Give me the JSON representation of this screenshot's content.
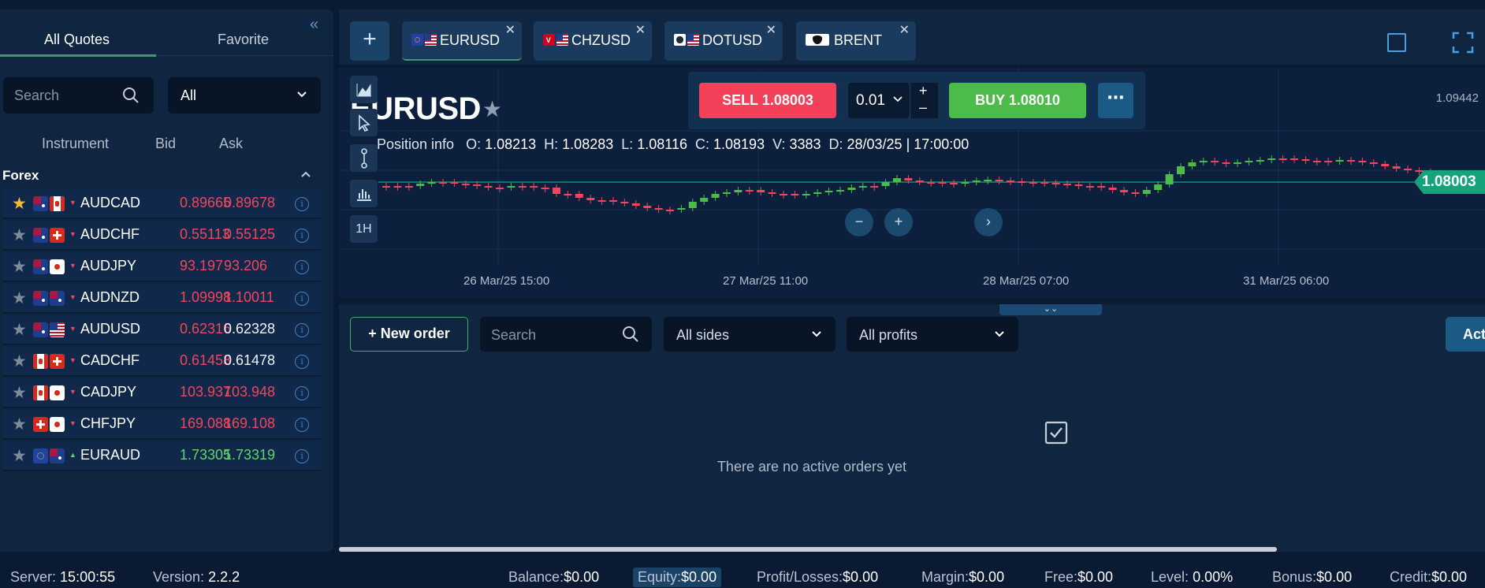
{
  "sidebar": {
    "tabs": [
      "All Quotes",
      "Favorite"
    ],
    "search_placeholder": "Search",
    "filter_value": "All",
    "columns": [
      "Instrument",
      "Bid",
      "Ask"
    ],
    "group": "Forex",
    "quotes": [
      {
        "symbol": "AUDCAD",
        "bid": "0.89665",
        "ask": "0.89678",
        "bid_color": "red",
        "ask_color": "red",
        "dir": "down",
        "fav": true,
        "flags": [
          "au",
          "ca"
        ]
      },
      {
        "symbol": "AUDCHF",
        "bid": "0.55113",
        "ask": "0.55125",
        "bid_color": "red",
        "ask_color": "red",
        "dir": "down",
        "fav": false,
        "flags": [
          "au",
          "ch"
        ]
      },
      {
        "symbol": "AUDJPY",
        "bid": "93.197",
        "ask": "93.206",
        "bid_color": "red",
        "ask_color": "red",
        "dir": "down",
        "fav": false,
        "flags": [
          "au",
          "jp"
        ]
      },
      {
        "symbol": "AUDNZD",
        "bid": "1.09998",
        "ask": "1.10011",
        "bid_color": "red",
        "ask_color": "red",
        "dir": "down",
        "fav": false,
        "flags": [
          "au",
          "nz"
        ]
      },
      {
        "symbol": "AUDUSD",
        "bid": "0.62316",
        "ask": "0.62328",
        "bid_color": "red",
        "ask_color": "white",
        "dir": "down",
        "fav": false,
        "flags": [
          "au",
          "us"
        ]
      },
      {
        "symbol": "CADCHF",
        "bid": "0.61458",
        "ask": "0.61478",
        "bid_color": "red",
        "ask_color": "white",
        "dir": "down",
        "fav": false,
        "flags": [
          "ca",
          "ch"
        ]
      },
      {
        "symbol": "CADJPY",
        "bid": "103.937",
        "ask": "103.948",
        "bid_color": "red",
        "ask_color": "red",
        "dir": "down",
        "fav": false,
        "flags": [
          "ca",
          "jp"
        ]
      },
      {
        "symbol": "CHFJPY",
        "bid": "169.088",
        "ask": "169.108",
        "bid_color": "red",
        "ask_color": "red",
        "dir": "down",
        "fav": false,
        "flags": [
          "ch",
          "jp"
        ]
      },
      {
        "symbol": "EURAUD",
        "bid": "1.73305",
        "ask": "1.73319",
        "bid_color": "green",
        "ask_color": "green",
        "dir": "up",
        "fav": false,
        "flags": [
          "eu",
          "au"
        ]
      }
    ]
  },
  "chart_tabs": [
    {
      "label": "EURUSD",
      "active": true,
      "flags": [
        "eu",
        "us"
      ]
    },
    {
      "label": "CHZUSD",
      "active": false,
      "flags": [
        "chz",
        "us"
      ]
    },
    {
      "label": "DOTUSD",
      "active": false,
      "flags": [
        "dot",
        "us"
      ]
    },
    {
      "label": "BRENT",
      "active": false,
      "flags": [
        "oil"
      ]
    }
  ],
  "chart": {
    "symbol_title": "EURUSD",
    "position_info": "Position info",
    "ohlc": {
      "O": "1.08213",
      "H": "1.08283",
      "L": "1.08116",
      "C": "1.08193",
      "V": "3383",
      "D": "28/03/25 | 17:00:00"
    },
    "top_price": "1.09442",
    "current_price": "1.08003",
    "timeframe": "1H",
    "x_labels": [
      "26 Mar/25 15:00",
      "27 Mar/25 11:00",
      "28 Mar/25 07:00",
      "31 Mar/25 06:00"
    ]
  },
  "trade": {
    "sell_label": "SELL 1.08003",
    "buy_label": "BUY 1.08010",
    "lot": "0.01",
    "plus": "+",
    "minus": "–",
    "more": "⋯"
  },
  "orders": {
    "new_order": "New order",
    "search_placeholder": "Search",
    "sides": "All sides",
    "profits": "All profits",
    "active_btn": "Act",
    "empty_text": "There are no active orders yet"
  },
  "status": {
    "server_label": "Server:",
    "server": "15:00:55",
    "version_label": "Version:",
    "version": "2.2.2",
    "balance_label": "Balance:",
    "balance": "$0.00",
    "equity_label": "Equity:",
    "equity": "$0.00",
    "pl_label": "Profit/Losses:",
    "pl": "$0.00",
    "margin_label": "Margin:",
    "margin": "$0.00",
    "free_label": "Free:",
    "free": "$0.00",
    "level_label": "Level:",
    "level": "0.00%",
    "bonus_label": "Bonus:",
    "bonus": "$0.00",
    "credit_label": "Credit:",
    "credit": "$0.00"
  },
  "colors": {
    "red": "#f2455b",
    "green": "#62d36c",
    "white": "#f0f3f7",
    "accent": "#3f9a6b"
  }
}
